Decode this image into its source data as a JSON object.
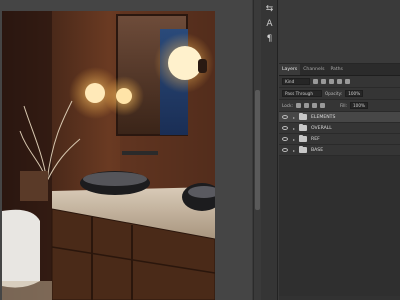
{
  "app": {
    "tools": [
      "⇆",
      "A",
      "¶"
    ]
  },
  "panel": {
    "tabs": [
      "Layers",
      "Channels",
      "Paths"
    ],
    "filter": {
      "value": "Kind"
    },
    "blend_mode": "Pass Through",
    "opacity_label": "Opacity:",
    "opacity_value": "100%",
    "lock_label": "Lock:",
    "fill_label": "Fill:",
    "fill_value": "100%",
    "layers": [
      {
        "name": "ELEMENTS",
        "selected": true
      },
      {
        "name": "OVERALL",
        "selected": false
      },
      {
        "name": "REF",
        "selected": false
      },
      {
        "name": "BASE",
        "selected": false
      }
    ]
  },
  "colors": {
    "accent": "#d98d4a",
    "canvas_bg": "#454545",
    "panel_bg": "#323232"
  }
}
